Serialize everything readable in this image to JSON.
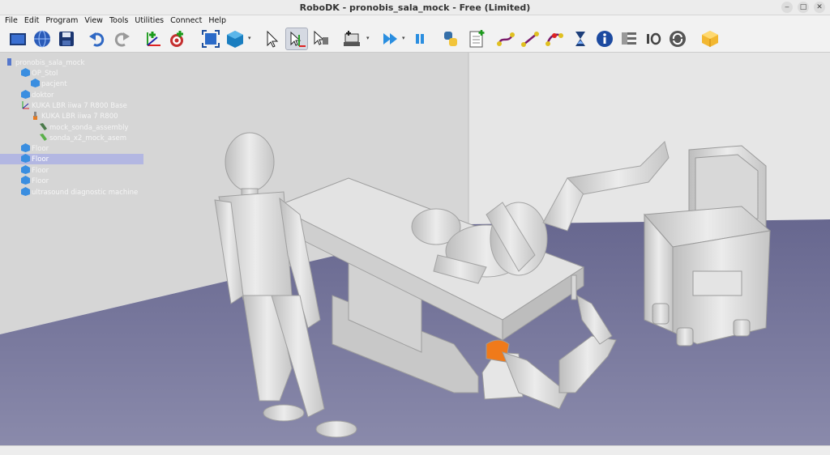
{
  "window": {
    "title": "RoboDK - pronobis_sala_mock - Free (Limited)",
    "minimize": "‒",
    "maximize": "□",
    "close": "✕"
  },
  "menu": [
    "File",
    "Edit",
    "Program",
    "View",
    "Tools",
    "Utilities",
    "Connect",
    "Help"
  ],
  "toolbar": {
    "buttons": [
      "open-icon",
      "online-library-icon",
      "save-icon",
      "undo-icon",
      "redo-icon",
      "add-reference-frame-icon",
      "add-target-icon",
      "fit-all-icon",
      "isometric-view-icon",
      "select-icon",
      "move-reference-icon",
      "move-tool-icon",
      "add-program-icon",
      "run-icon",
      "pause-icon",
      "python-icon",
      "add-program-instruction-icon",
      "joint-move-icon",
      "linear-move-icon",
      "circular-move-icon",
      "pause-instruction-icon",
      "info-icon",
      "set-reference-icon",
      "io-icon",
      "call-program-icon",
      "package-icon"
    ],
    "active": "move-reference-icon"
  },
  "tree": [
    {
      "label": "pronobis_sala_mock",
      "level": 0,
      "icon": "station-icon"
    },
    {
      "label": "OP_Stol",
      "level": 1,
      "icon": "object-icon"
    },
    {
      "label": "pacjent",
      "level": 2,
      "icon": "object-icon"
    },
    {
      "label": "doktor",
      "level": 1,
      "icon": "object-icon"
    },
    {
      "label": "KUKA LBR iiwa 7 R800 Base",
      "level": 1,
      "icon": "frame-icon"
    },
    {
      "label": "KUKA LBR iiwa 7 R800",
      "level": 2,
      "icon": "robot-icon"
    },
    {
      "label": "mock_sonda_assembly",
      "level": 3,
      "icon": "tool-icon"
    },
    {
      "label": "sonda_x2_mock_asem",
      "level": 3,
      "icon": "tool-icon"
    },
    {
      "label": "Floor",
      "level": 1,
      "icon": "object-icon"
    },
    {
      "label": "Floor",
      "level": 1,
      "icon": "object-icon",
      "selected": true
    },
    {
      "label": "Floor",
      "level": 1,
      "icon": "object-icon"
    },
    {
      "label": "Floor",
      "level": 1,
      "icon": "object-icon"
    },
    {
      "label": "ultrasound diagnostic machine",
      "level": 1,
      "icon": "object-icon"
    }
  ],
  "colors": {
    "floor": "#76769a",
    "wall": "#d9d9d9",
    "selection": "#b3b7e2",
    "toolbar_bg": "#f2f2f2",
    "tool_orange": "#f07a1a"
  }
}
